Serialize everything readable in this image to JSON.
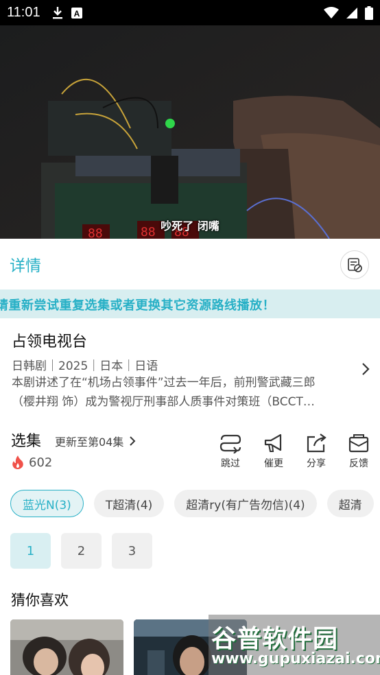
{
  "status_bar": {
    "time": "11:01"
  },
  "video": {
    "subtitle": "吵死了 闭嘴"
  },
  "details": {
    "title": "详情"
  },
  "notice": {
    "text": "请重新尝试重复选集或者更换其它资源路线播放！"
  },
  "show": {
    "title": "占领电视台",
    "meta": "日韩剧｜2025｜日本｜日语",
    "description_line1": "本剧讲述了在“机场占领事件”过去一年后，前刑警武藏三郎",
    "description_line2": "（樱井翔 饰）成为警视厅刑事部人质事件对策班（BCCT…"
  },
  "episodes": {
    "title": "选集",
    "update": "更新至第04集",
    "heat": "602"
  },
  "actions": [
    {
      "label": "跳过",
      "icon": "skip-icon"
    },
    {
      "label": "催更",
      "icon": "megaphone-icon"
    },
    {
      "label": "分享",
      "icon": "share-icon"
    },
    {
      "label": "反馈",
      "icon": "feedback-mail-icon"
    }
  ],
  "sources": [
    "蓝光N(3)",
    "T超清(4)",
    "超清ry(有广告勿信)(4)",
    "超清"
  ],
  "active_source": 0,
  "pages": [
    "1",
    "2",
    "3"
  ],
  "active_page": 0,
  "recommend": {
    "title": "猜你喜欢"
  },
  "watermark": {
    "main": "谷普软件园",
    "url": "www.gupuxiazai.com"
  },
  "colors": {
    "accent": "#27b0c6",
    "notice_bg": "#d8eef0",
    "heat": "#f0524a"
  }
}
